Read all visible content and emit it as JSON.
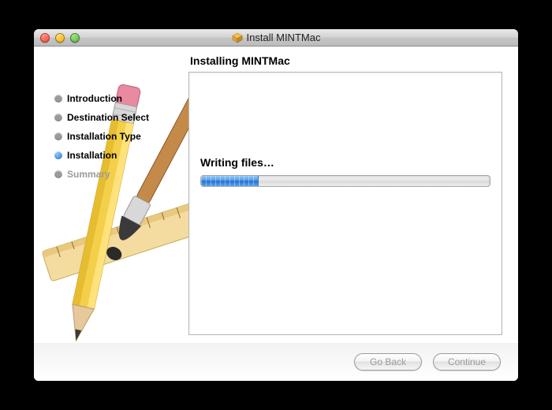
{
  "window": {
    "title": "Install MINTMac"
  },
  "header": {
    "title": "Installing MINTMac"
  },
  "sidebar": {
    "steps": [
      {
        "label": "Introduction",
        "state": "done"
      },
      {
        "label": "Destination Select",
        "state": "done"
      },
      {
        "label": "Installation Type",
        "state": "done"
      },
      {
        "label": "Installation",
        "state": "active"
      },
      {
        "label": "Summary",
        "state": "pending"
      }
    ]
  },
  "main": {
    "status_text": "Writing files…",
    "progress_percent": 20
  },
  "footer": {
    "go_back_label": "Go Back",
    "continue_label": "Continue",
    "go_back_enabled": false,
    "continue_enabled": false
  }
}
